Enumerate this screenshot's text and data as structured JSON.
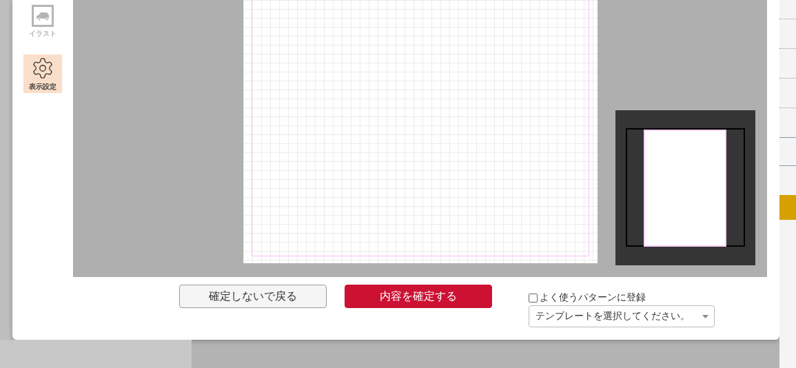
{
  "sidebar": {
    "items": [
      {
        "kind": "illustration",
        "label": "イラスト",
        "selected": false,
        "disabled": true
      },
      {
        "kind": "settings",
        "label": "表示設定",
        "selected": true,
        "disabled": false
      }
    ]
  },
  "footer": {
    "cancel_button": "確定しないで戻る",
    "confirm_button": "内容を確定する",
    "save_pattern": {
      "label": "よく使うパターンに登録",
      "checked": false
    },
    "template_select": {
      "value": "テンプレートを選択してください。"
    }
  }
}
